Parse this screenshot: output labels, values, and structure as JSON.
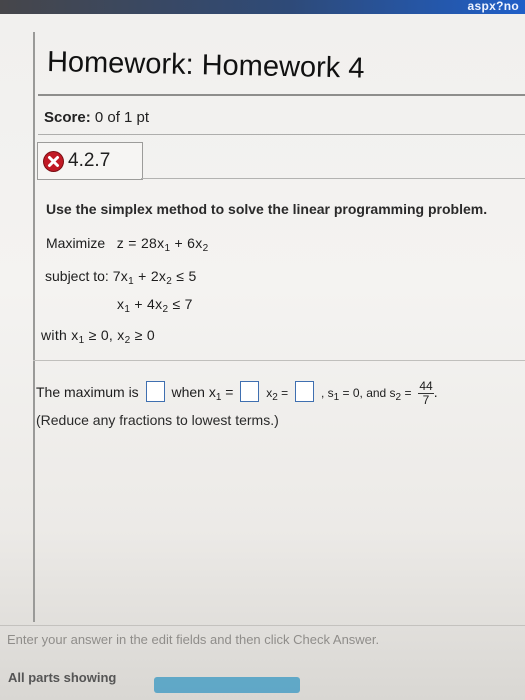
{
  "browser": {
    "url_fragment": "aspx?no"
  },
  "header": {
    "title": "Homework: Homework 4",
    "score_label": "Score:",
    "score_value": "0 of 1 pt"
  },
  "question": {
    "number": "4.2.7",
    "status_icon": "incorrect-x-icon",
    "status_color": "#c11a25",
    "instructions": "Use the simplex method to solve the linear programming problem.",
    "maximize_label": "Maximize",
    "objective": {
      "lhs": "z = 28x",
      "var1_sub": "1",
      "plus": " + 6x",
      "var2_sub": "2"
    },
    "subject_to_label": "subject to:",
    "constraint1": {
      "a": "7x",
      "a_sub": "1",
      "b": " + 2x",
      "b_sub": "2",
      "rhs": " ≤ 5"
    },
    "constraint2": {
      "a": "x",
      "a_sub": "1",
      "b": " + 4x",
      "b_sub": "2",
      "rhs": " ≤ 7"
    },
    "nonneg": {
      "prefix": "with x",
      "a_sub": "1",
      "mid": " ≥ 0, x",
      "b_sub": "2",
      "rhs": " ≥ 0"
    }
  },
  "answer": {
    "max_text": "The maximum is",
    "when_text": "when x",
    "x1_sub": "1",
    "eq1": " =",
    "x2_text": "x",
    "x2_sub": "2",
    "eq2": " =",
    "s1_text": ", s",
    "s1_sub": "1",
    "s1_value": " = 0, and s",
    "s2_sub": "2",
    "s2_eq": " =",
    "s2_num": "44",
    "s2_den": "7",
    "period": ".",
    "max_value": "",
    "x1_value": "",
    "x2_value": "",
    "reduce_note": "(Reduce any fractions to lowest terms.)"
  },
  "footer": {
    "hint": "Enter your answer in the edit fields and then click Check Answer.",
    "parts_label": "All parts showing",
    "accent_color": "#4a9fc4"
  }
}
